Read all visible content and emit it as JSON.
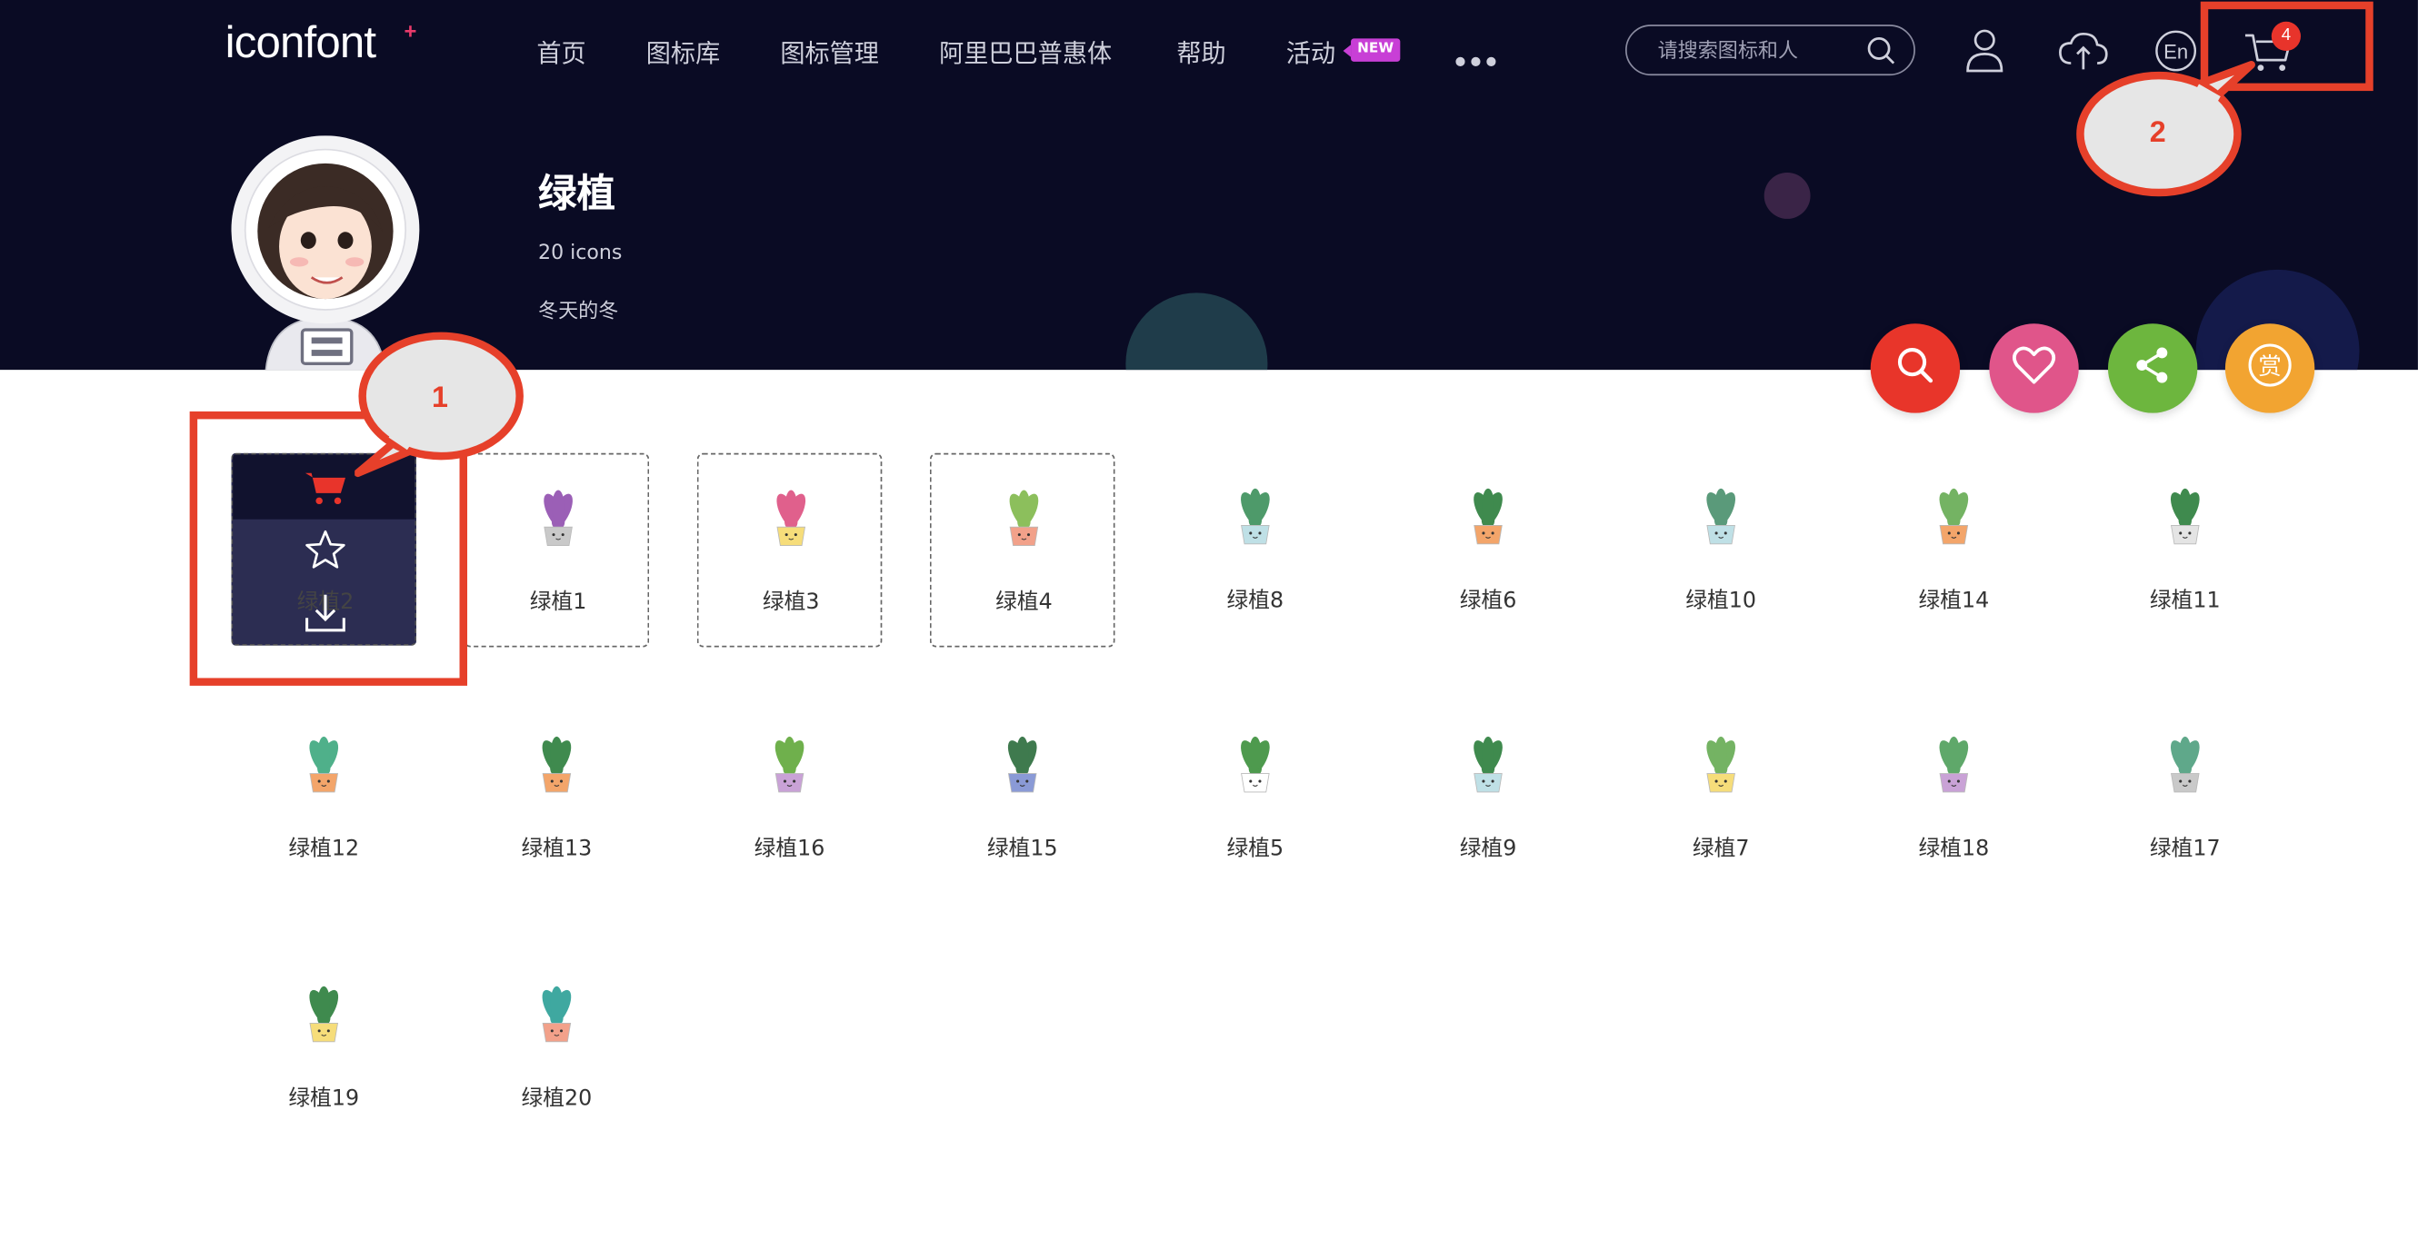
{
  "header": {
    "logo": "iconfont",
    "logo_plus": "+",
    "nav": [
      "首页",
      "图标库",
      "图标管理",
      "阿里巴巴普惠体",
      "帮助",
      "活动"
    ],
    "new_badge": "NEW",
    "search_placeholder": "请搜索图标和人",
    "lang": "En",
    "cart_count": "4"
  },
  "project": {
    "title": "绿植",
    "count": "20 icons",
    "author": "冬天的冬"
  },
  "actions": {
    "colors": [
      "#e8352a",
      "#e0558a",
      "#6db63e",
      "#f2a431"
    ],
    "reward_label": "赏"
  },
  "hover_card": {
    "label": "绿植2"
  },
  "icons": [
    {
      "label": "绿植1",
      "pot": "#c9c9c9",
      "leaf": "#9b5fb6"
    },
    {
      "label": "绿植3",
      "pot": "#f6dd7a",
      "leaf": "#e0608c"
    },
    {
      "label": "绿植4",
      "pot": "#f2a18a",
      "leaf": "#8cbf5c"
    },
    {
      "label": "绿植8",
      "pot": "#bfe0e6",
      "leaf": "#4e9a6a"
    },
    {
      "label": "绿植6",
      "pot": "#f3a56a",
      "leaf": "#3f8a4e"
    },
    {
      "label": "绿植10",
      "pot": "#bfe0e6",
      "leaf": "#5a9a7a"
    },
    {
      "label": "绿植14",
      "pot": "#f3a56a",
      "leaf": "#74b363"
    },
    {
      "label": "绿植11",
      "pot": "#e4e4e4",
      "leaf": "#3f8a4e"
    },
    {
      "label": "绿植12",
      "pot": "#f3a56a",
      "leaf": "#4fb08a"
    },
    {
      "label": "绿植13",
      "pot": "#f3a56a",
      "leaf": "#3f8a4e"
    },
    {
      "label": "绿植16",
      "pot": "#c9a2d6",
      "leaf": "#6fb04c"
    },
    {
      "label": "绿植15",
      "pot": "#8a9ad6",
      "leaf": "#3f7a4e"
    },
    {
      "label": "绿植5",
      "pot": "#ffffff",
      "leaf": "#4e9a4e"
    },
    {
      "label": "绿植9",
      "pot": "#bfe0e6",
      "leaf": "#3f8a4e"
    },
    {
      "label": "绿植7",
      "pot": "#f6dd7a",
      "leaf": "#74b363"
    },
    {
      "label": "绿植18",
      "pot": "#c9a2d6",
      "leaf": "#5fa86a"
    },
    {
      "label": "绿植17",
      "pot": "#c9c9c9",
      "leaf": "#5fa88a"
    },
    {
      "label": "绿植19",
      "pot": "#f6dd7a",
      "leaf": "#3f8a4e"
    },
    {
      "label": "绿植20",
      "pot": "#f2a18a",
      "leaf": "#3fa8a0"
    }
  ],
  "annotations": {
    "callout_1": "1",
    "callout_2": "2",
    "color": "#e6402a"
  }
}
